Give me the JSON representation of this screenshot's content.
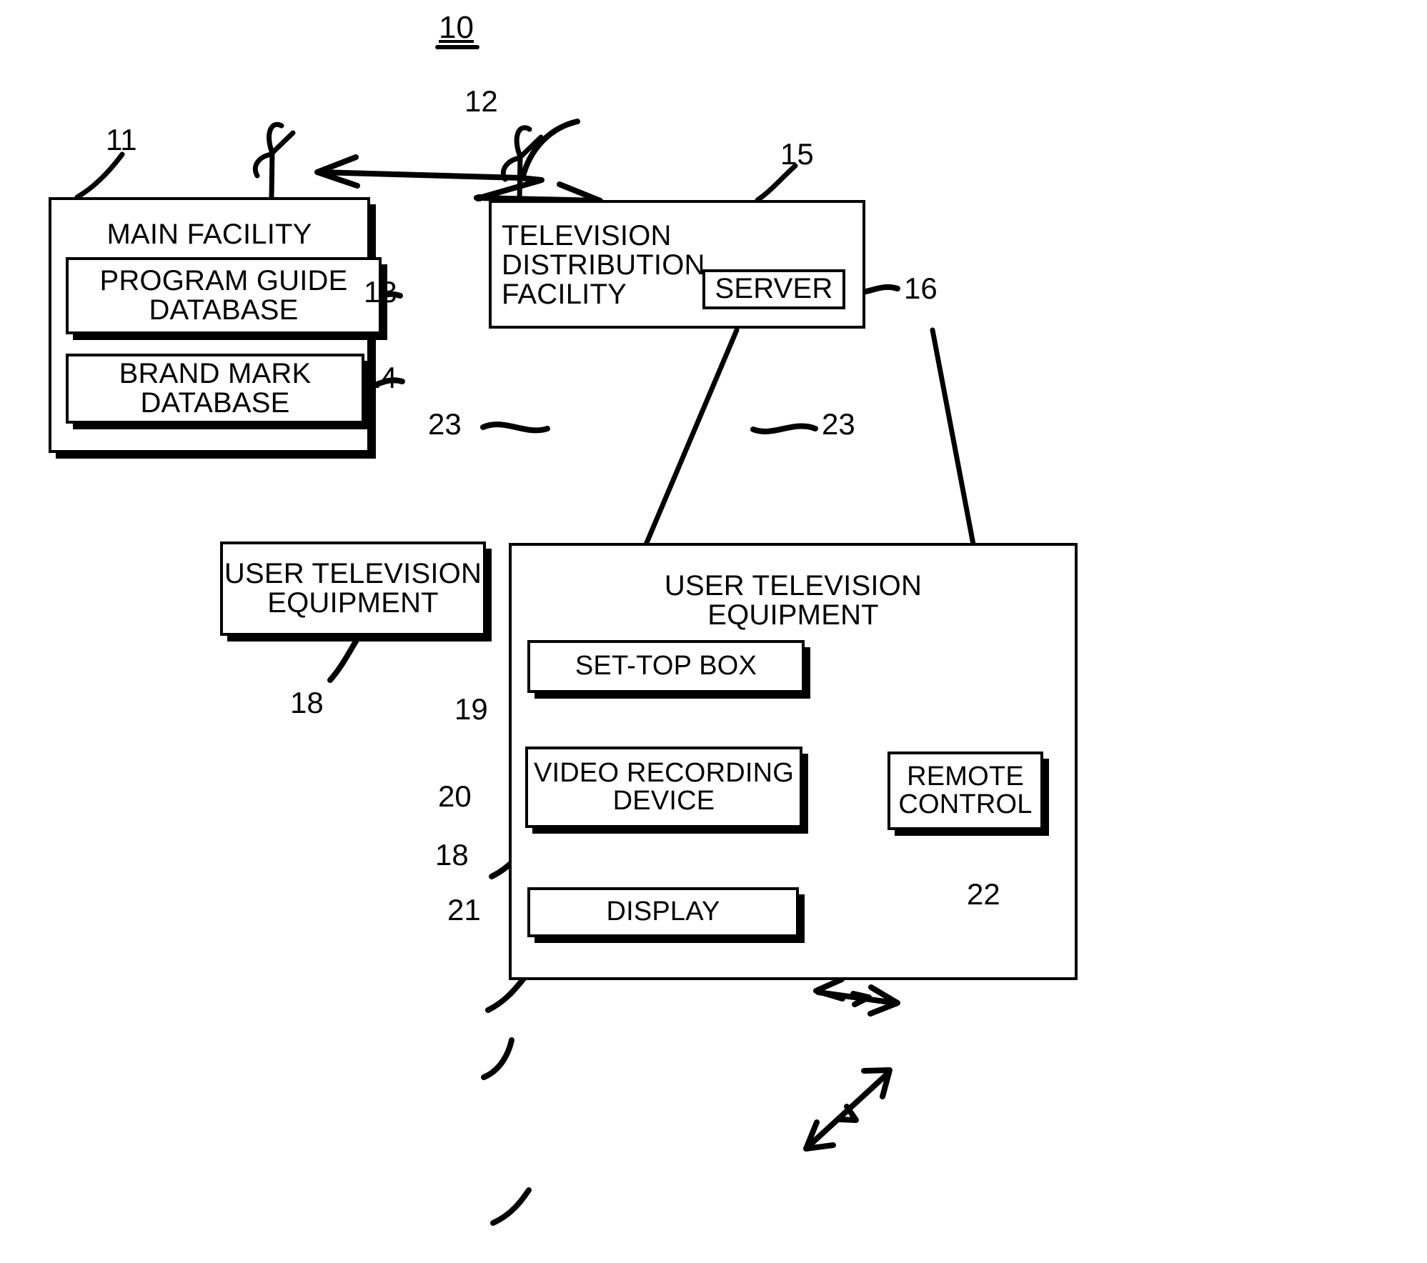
{
  "figure": {
    "figure_number": "10",
    "type": "patent-block-diagram",
    "background": "#ffffff",
    "ink": "#000000"
  },
  "boxes": {
    "main_facility": {
      "label": "MAIN FACILITY",
      "ref": "11"
    },
    "program_guide_database": {
      "label": "PROGRAM GUIDE\nDATABASE",
      "ref": "13"
    },
    "brand_mark_database": {
      "label": "BRAND MARK\nDATABASE",
      "ref": "14"
    },
    "television_distribution_facility": {
      "label": "TELEVISION DISTRIBUTION\nFACILITY",
      "ref": "15"
    },
    "server": {
      "label": "SERVER",
      "ref": "16"
    },
    "user_television_equipment_left": {
      "label": "USER TELEVISION\nEQUIPMENT",
      "ref": "18"
    },
    "user_television_equipment_right": {
      "label": "USER TELEVISION\nEQUIPMENT",
      "ref": "18"
    },
    "set_top_box": {
      "label": "SET-TOP BOX",
      "ref": "19"
    },
    "video_recording_device": {
      "label": "VIDEO RECORDING\nDEVICE",
      "ref": "20"
    },
    "display": {
      "label": "DISPLAY",
      "ref": "21"
    },
    "remote_control": {
      "label": "REMOTE\nCONTROL",
      "ref": "22"
    }
  },
  "reference_numerals": {
    "n10": "10",
    "n11": "11",
    "n12": "12",
    "n13": "13",
    "n14": "14",
    "n15": "15",
    "n16": "16",
    "n18a": "18",
    "n18b": "18",
    "n19": "19",
    "n20": "20",
    "n21": "21",
    "n22": "22",
    "n23a": "23",
    "n23b": "23"
  },
  "connections": {
    "wireless_link": {
      "ref": "12",
      "description": "bidirectional antenna link between main facility and television distribution facility"
    },
    "distribution_paths": {
      "ref": "23",
      "description": "communications paths from television distribution facility to user television equipment"
    },
    "ellipsis": "▪ ▪ ▪"
  }
}
